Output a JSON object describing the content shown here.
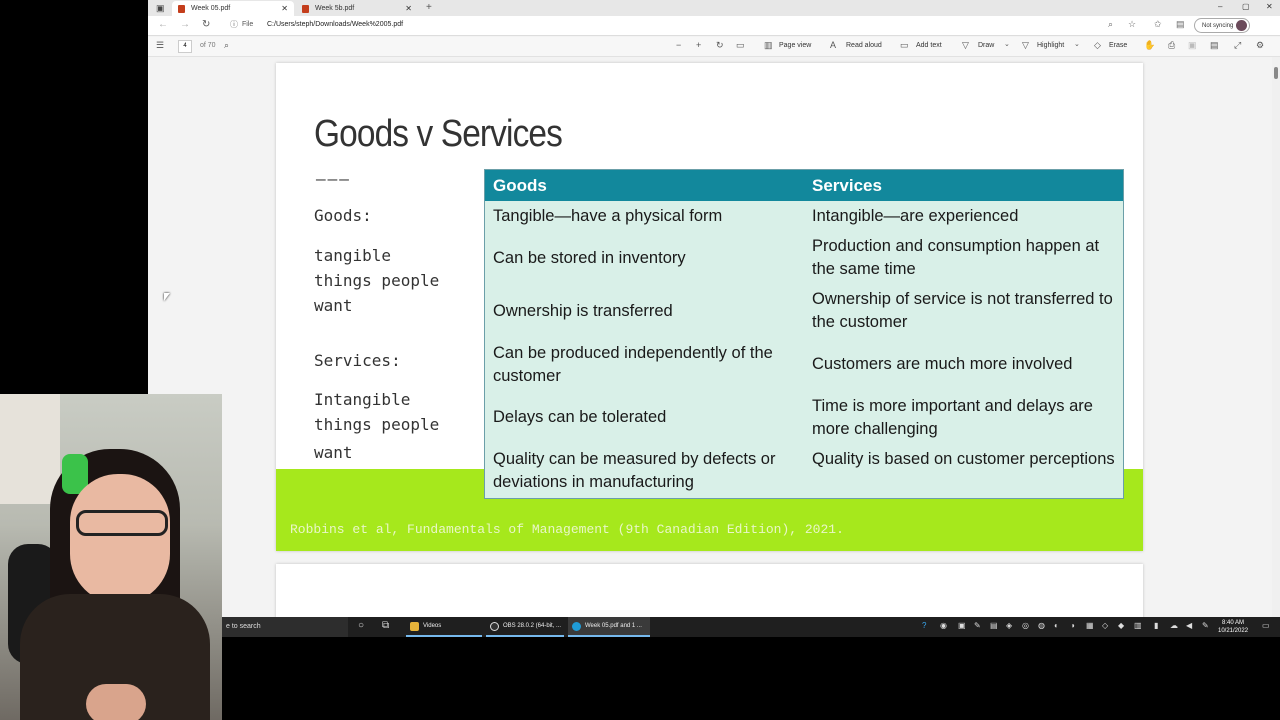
{
  "tabs": [
    {
      "label": "Week 05.pdf",
      "active": true
    },
    {
      "label": "Week 5b.pdf",
      "active": false
    }
  ],
  "address": {
    "file_label": "File",
    "url": "C:/Users/steph/Downloads/Week%2005.pdf"
  },
  "profile": {
    "sync_label": "Not syncing"
  },
  "pdf_toolbar": {
    "page_current": "4",
    "page_total": "of 70",
    "page_view": "Page view",
    "read_aloud": "Read aloud",
    "add_text": "Add text",
    "draw": "Draw",
    "highlight": "Highlight",
    "erase": "Erase"
  },
  "slide": {
    "title": "Goods v Services",
    "dashes": "———",
    "goods_label": "Goods:",
    "goods_def_1": "tangible",
    "goods_def_2": "things people",
    "goods_def_3": "want",
    "services_label": "Services:",
    "services_def_1": "Intangible",
    "services_def_2": "things people",
    "services_def_3": "want",
    "citation": "Robbins et al, Fundamentals of Management (9th Canadian Edition), 2021.",
    "table": {
      "headers": [
        "Goods",
        "Services"
      ],
      "rows": [
        [
          "Tangible—have a physical form",
          "Intangible—are experienced"
        ],
        [
          "Can be stored in inventory",
          "Production and consumption happen at the same time"
        ],
        [
          "Ownership is transferred",
          "Ownership of service is not transferred to the customer"
        ],
        [
          "Can be produced independently of the customer",
          "Customers are much more involved"
        ],
        [
          "Delays can be tolerated",
          "Time is more important and delays are more challenging"
        ],
        [
          "Quality can be measured by defects or deviations in manufacturing",
          "Quality is based on customer perceptions"
        ]
      ]
    }
  },
  "taskbar": {
    "search_placeholder": "e to search",
    "apps": [
      {
        "label": "Videos"
      },
      {
        "label": "OBS 28.0.2 (64-bit, ..."
      },
      {
        "label": "Week 05.pdf and 1 ..."
      }
    ],
    "time": "8:40 AM",
    "date": "10/21/2022"
  },
  "colors": {
    "table_header": "#12889c",
    "table_body": "#d9f0e8",
    "green_band": "#a6e81c"
  }
}
